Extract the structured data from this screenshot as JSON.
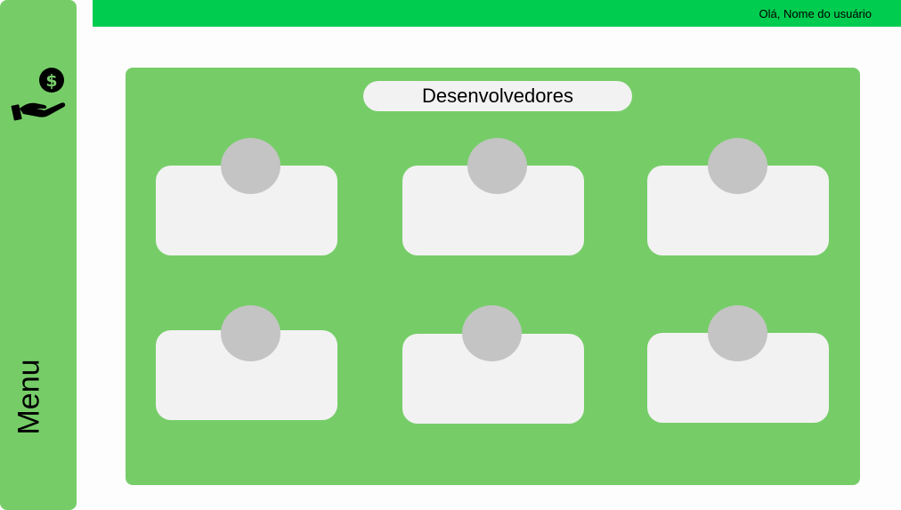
{
  "sidebar": {
    "logo_icon": "hand-holding-dollar-icon",
    "menu_label": "Menu"
  },
  "header": {
    "greeting": "Olá, Nome do usuário"
  },
  "main": {
    "title": "Desenvolvedores",
    "cards": [
      {
        "avatar": "avatar-placeholder"
      },
      {
        "avatar": "avatar-placeholder"
      },
      {
        "avatar": "avatar-placeholder"
      },
      {
        "avatar": "avatar-placeholder"
      },
      {
        "avatar": "avatar-placeholder"
      },
      {
        "avatar": "avatar-placeholder"
      }
    ]
  },
  "colors": {
    "sidebar": "#76cd68",
    "topbar": "#00cc4f",
    "panel": "#76cd68",
    "card": "#f2f2f2",
    "avatar": "#c4c4c4"
  }
}
